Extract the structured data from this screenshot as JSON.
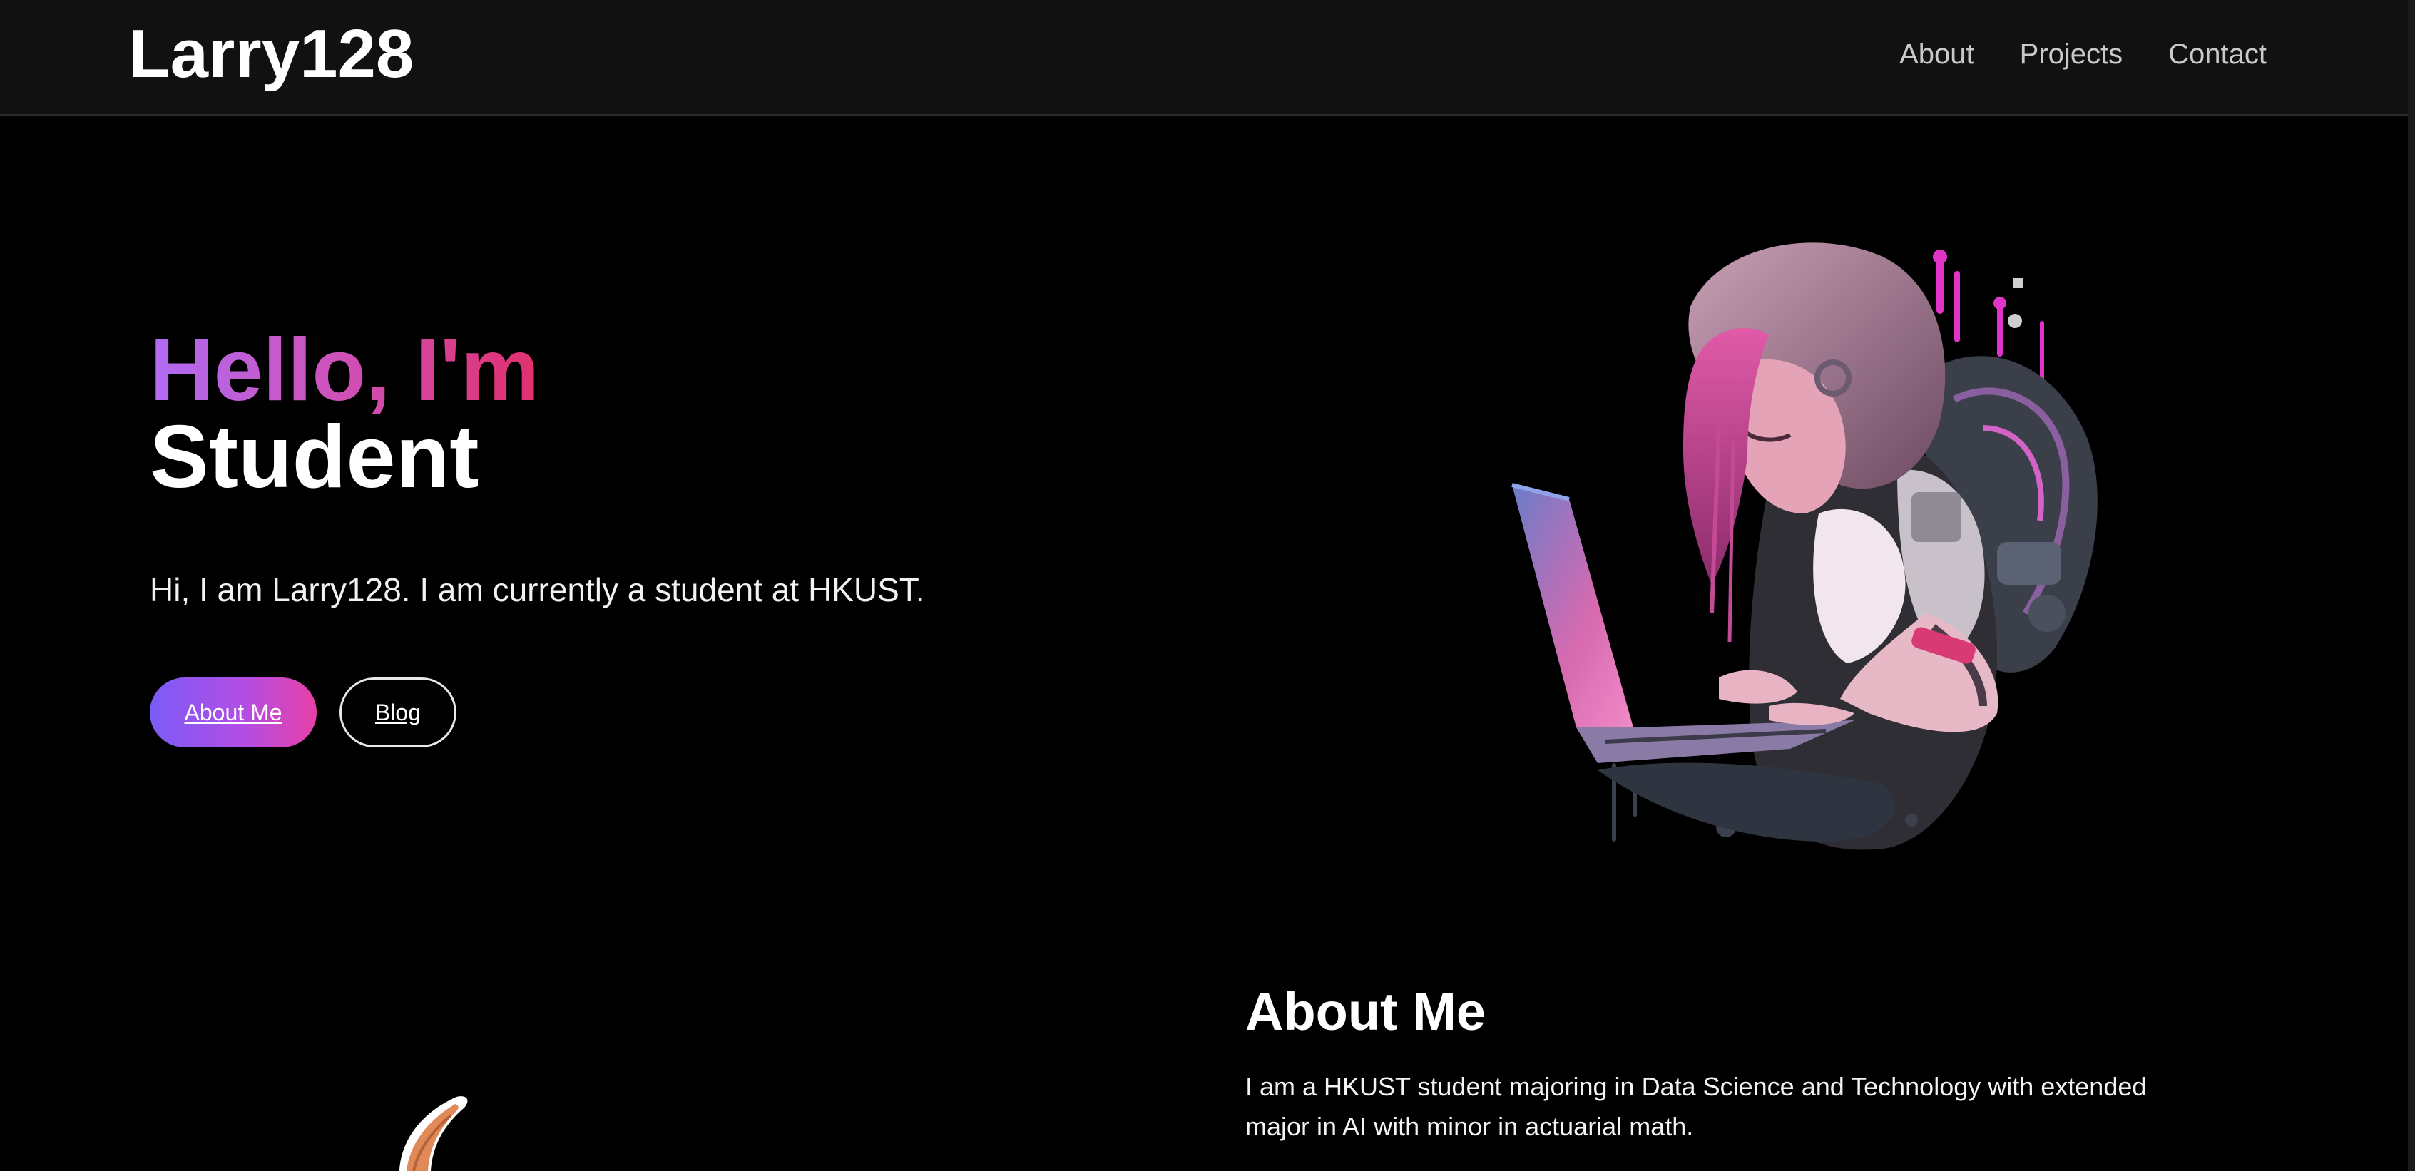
{
  "header": {
    "brand": "Larry128",
    "nav": [
      {
        "label": "About"
      },
      {
        "label": "Projects"
      },
      {
        "label": "Contact"
      }
    ]
  },
  "hero": {
    "greeting": "Hello, I'm",
    "role": "Student",
    "intro": "Hi, I am Larry128. I am currently a student at HKUST.",
    "primary_button": "About Me",
    "secondary_button": "Blog"
  },
  "about": {
    "title": "About Me",
    "text": "I am a HKUST student majoring in Data Science and Technology with extended major in AI with minor in actuarial math."
  },
  "colors": {
    "background": "#000000",
    "header_bg": "#111111",
    "gradient_start": "#b06cf4",
    "gradient_end": "#e0306d",
    "button_start": "#7b5cf6",
    "button_end": "#e840a6"
  },
  "images": {
    "hero": "hacker-girl-laptop-illustration",
    "about": "cartoon-character-illustration"
  }
}
